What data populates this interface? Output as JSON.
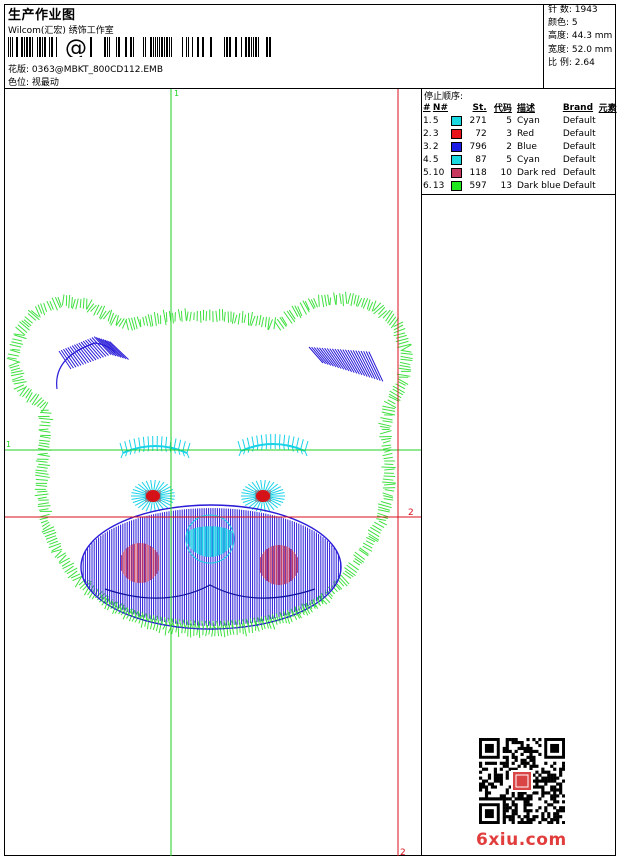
{
  "header": {
    "title": "生产作业图",
    "subtitle": "Wilcom(汇宏) 绣饰工作室",
    "barcode_text": "@",
    "file_label": "花版: 0363@MBKT_800CD112.EMB",
    "color_position": "色位: 视最动"
  },
  "info": {
    "stitches": "针 数: 1943",
    "colors": "颜色: 5",
    "height": "高度: 44.3 mm",
    "width": "宽度: 52.0 mm",
    "ratio": "比 例: 2.64"
  },
  "stop_sequence": {
    "title": "停止顺序:",
    "headers": [
      "#",
      "N#",
      "St.",
      "代码",
      "描述",
      "Brand",
      "元素"
    ],
    "rows": [
      {
        "num": "1.",
        "n": "5",
        "color": "#19d8e0",
        "st": "271",
        "code": "5",
        "desc": "Cyan",
        "brand": "Default"
      },
      {
        "num": "2.",
        "n": "3",
        "color": "#e8141a",
        "st": "72",
        "code": "3",
        "desc": "Red",
        "brand": "Default"
      },
      {
        "num": "3.",
        "n": "2",
        "color": "#1c1ce6",
        "st": "796",
        "code": "2",
        "desc": "Blue",
        "brand": "Default"
      },
      {
        "num": "4.",
        "n": "5",
        "color": "#19d8e0",
        "st": "87",
        "code": "5",
        "desc": "Cyan",
        "brand": "Default"
      },
      {
        "num": "5.",
        "n": "10",
        "color": "#c7385e",
        "st": "118",
        "code": "10",
        "desc": "Dark red",
        "brand": "Default"
      },
      {
        "num": "6.",
        "n": "13",
        "color": "#1fe81f",
        "st": "597",
        "code": "13",
        "desc": "Dark blue",
        "brand": "Default"
      }
    ]
  },
  "guides": {
    "v1_label": "1",
    "h1_label": "1",
    "v2_label": "2",
    "h2_label": "2"
  },
  "colors": {
    "green_guide": "#1fd21f",
    "red_guide": "#d80f1e",
    "outline": "#3fe03f",
    "blue": "#2a1cd8",
    "cyan": "#1ad2e8",
    "pink": "#c7385e"
  },
  "footer": {
    "logo": "6xiu.com"
  }
}
